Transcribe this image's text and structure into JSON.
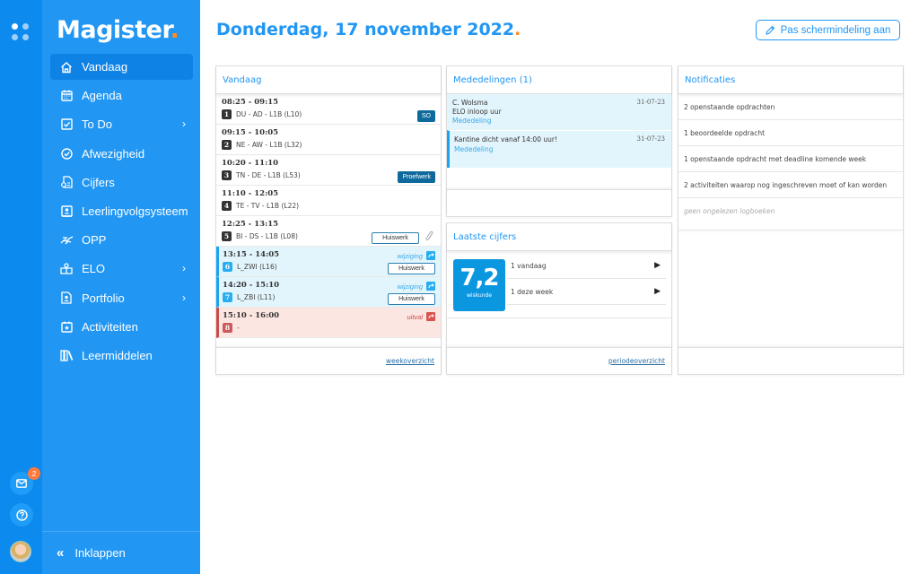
{
  "rail": {
    "messages_badge": "2"
  },
  "sidebar": {
    "brand": "Magister",
    "brand_dot": ".",
    "items": [
      {
        "label": "Vandaag",
        "icon": "home-icon",
        "active": true
      },
      {
        "label": "Agenda",
        "icon": "calendar-icon"
      },
      {
        "label": "To Do",
        "icon": "checkbox-icon",
        "chevron": true
      },
      {
        "label": "Afwezigheid",
        "icon": "check-circle-icon"
      },
      {
        "label": "Cijfers",
        "icon": "grades-icon"
      },
      {
        "label": "Leerlingvolgsysteem",
        "icon": "student-record-icon"
      },
      {
        "label": "OPP",
        "icon": "handshake-icon"
      },
      {
        "label": "ELO",
        "icon": "elo-icon",
        "chevron": true
      },
      {
        "label": "Portfolio",
        "icon": "portfolio-icon",
        "chevron": true
      },
      {
        "label": "Activiteiten",
        "icon": "activity-calendar-icon"
      },
      {
        "label": "Leermiddelen",
        "icon": "books-icon"
      }
    ],
    "collapse_label": "Inklappen"
  },
  "header": {
    "title": "Donderdag, 17 november 2022",
    "title_dot": ".",
    "layout_button": "Pas schermindeling aan"
  },
  "today": {
    "title": "Vandaag",
    "lessons": [
      {
        "time": "08:25 - 09:15",
        "hour": "1",
        "desc": "DU - AD - L1B (L10)",
        "tag": "SO"
      },
      {
        "time": "09:15 - 10:05",
        "hour": "2",
        "desc": "NE - AW - L1B (L32)"
      },
      {
        "time": "10:20 - 11:10",
        "hour": "3",
        "desc": "TN - DE - L1B (L53)",
        "tag": "Proefwerk"
      },
      {
        "time": "11:10 - 12:05",
        "hour": "4",
        "desc": "TE - TV - L1B (L22)"
      },
      {
        "time": "12:25 - 13:15",
        "hour": "5",
        "desc": "BI - DS - L1B (L08)",
        "homework": "Huiswerk",
        "attachment": true
      },
      {
        "time": "13:15 - 14:05",
        "hour": "6",
        "desc": "L_ZWI (L16)",
        "status": "wijziging",
        "homework": "Huiswerk"
      },
      {
        "time": "14:20 - 15:10",
        "hour": "7",
        "desc": "L_ZBI (L11)",
        "status": "wijziging",
        "homework": "Huiswerk"
      },
      {
        "time": "15:10 - 16:00",
        "hour": "8",
        "desc": "-",
        "status": "uitval"
      }
    ],
    "footer_link": "weekoverzicht"
  },
  "messages": {
    "title": "Mededelingen (1)",
    "items": [
      {
        "sender": "C. Wolsma",
        "subject": "ELO inloop uur",
        "kind": "Mededeling",
        "date": "31-07-23"
      },
      {
        "subject": "Kantine dicht vanaf 14:00 uur!",
        "kind": "Mededeling",
        "date": "31-07-23",
        "unread": true
      }
    ]
  },
  "grades": {
    "title": "Laatste cijfers",
    "latest_value": "7,2",
    "latest_subject": "wiskunde",
    "rows": [
      "1 vandaag",
      "1 deze week"
    ],
    "footer_link": "periodeoverzicht"
  },
  "notifications": {
    "title": "Notificaties",
    "items": [
      "2 openstaande opdrachten",
      "1 beoordeelde opdracht",
      "1 openstaande opdracht met deadline komende week",
      "2 activiteiten waarop nog ingeschreven moet of kan worden"
    ],
    "empty_note": "geen ongelezen logboeken"
  },
  "colors": {
    "brand": "#2196f3",
    "accent": "#ff8a1f",
    "change": "#1aa3f0",
    "cancel": "#cd4a4a"
  }
}
